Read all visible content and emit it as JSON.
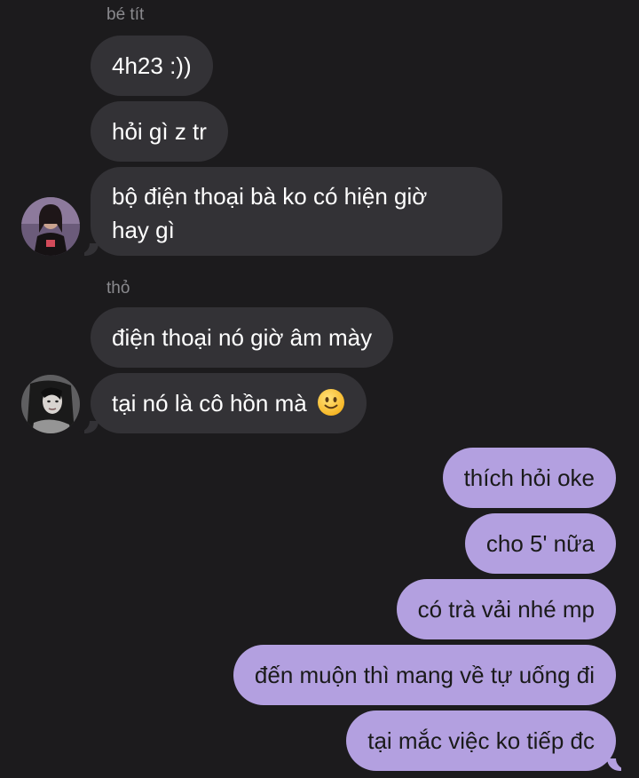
{
  "conversation": {
    "incoming_1": {
      "sender": "bé tít",
      "messages": [
        "4h23 :))",
        "hỏi gì z tr",
        "bộ điện thoại bà ko có hiện giờ",
        "hay gì"
      ]
    },
    "incoming_2": {
      "sender": "thỏ",
      "messages": [
        "điện thoại nó giờ âm mày",
        "tại nó là cô hồn mà"
      ],
      "emoji_icon": "slightly-smiling-face-icon"
    },
    "outgoing": {
      "messages": [
        "thích hỏi oke",
        "cho 5' nữa",
        "có trà vải nhé mp",
        "đến muộn thì mang về tự uống đi",
        "tại mắc việc ko tiếp đc"
      ]
    }
  },
  "colors": {
    "background": "#1c1b1d",
    "incoming_bubble": "#333236",
    "outgoing_bubble": "#b3a0e0",
    "sender_name": "#8a8a8e"
  }
}
